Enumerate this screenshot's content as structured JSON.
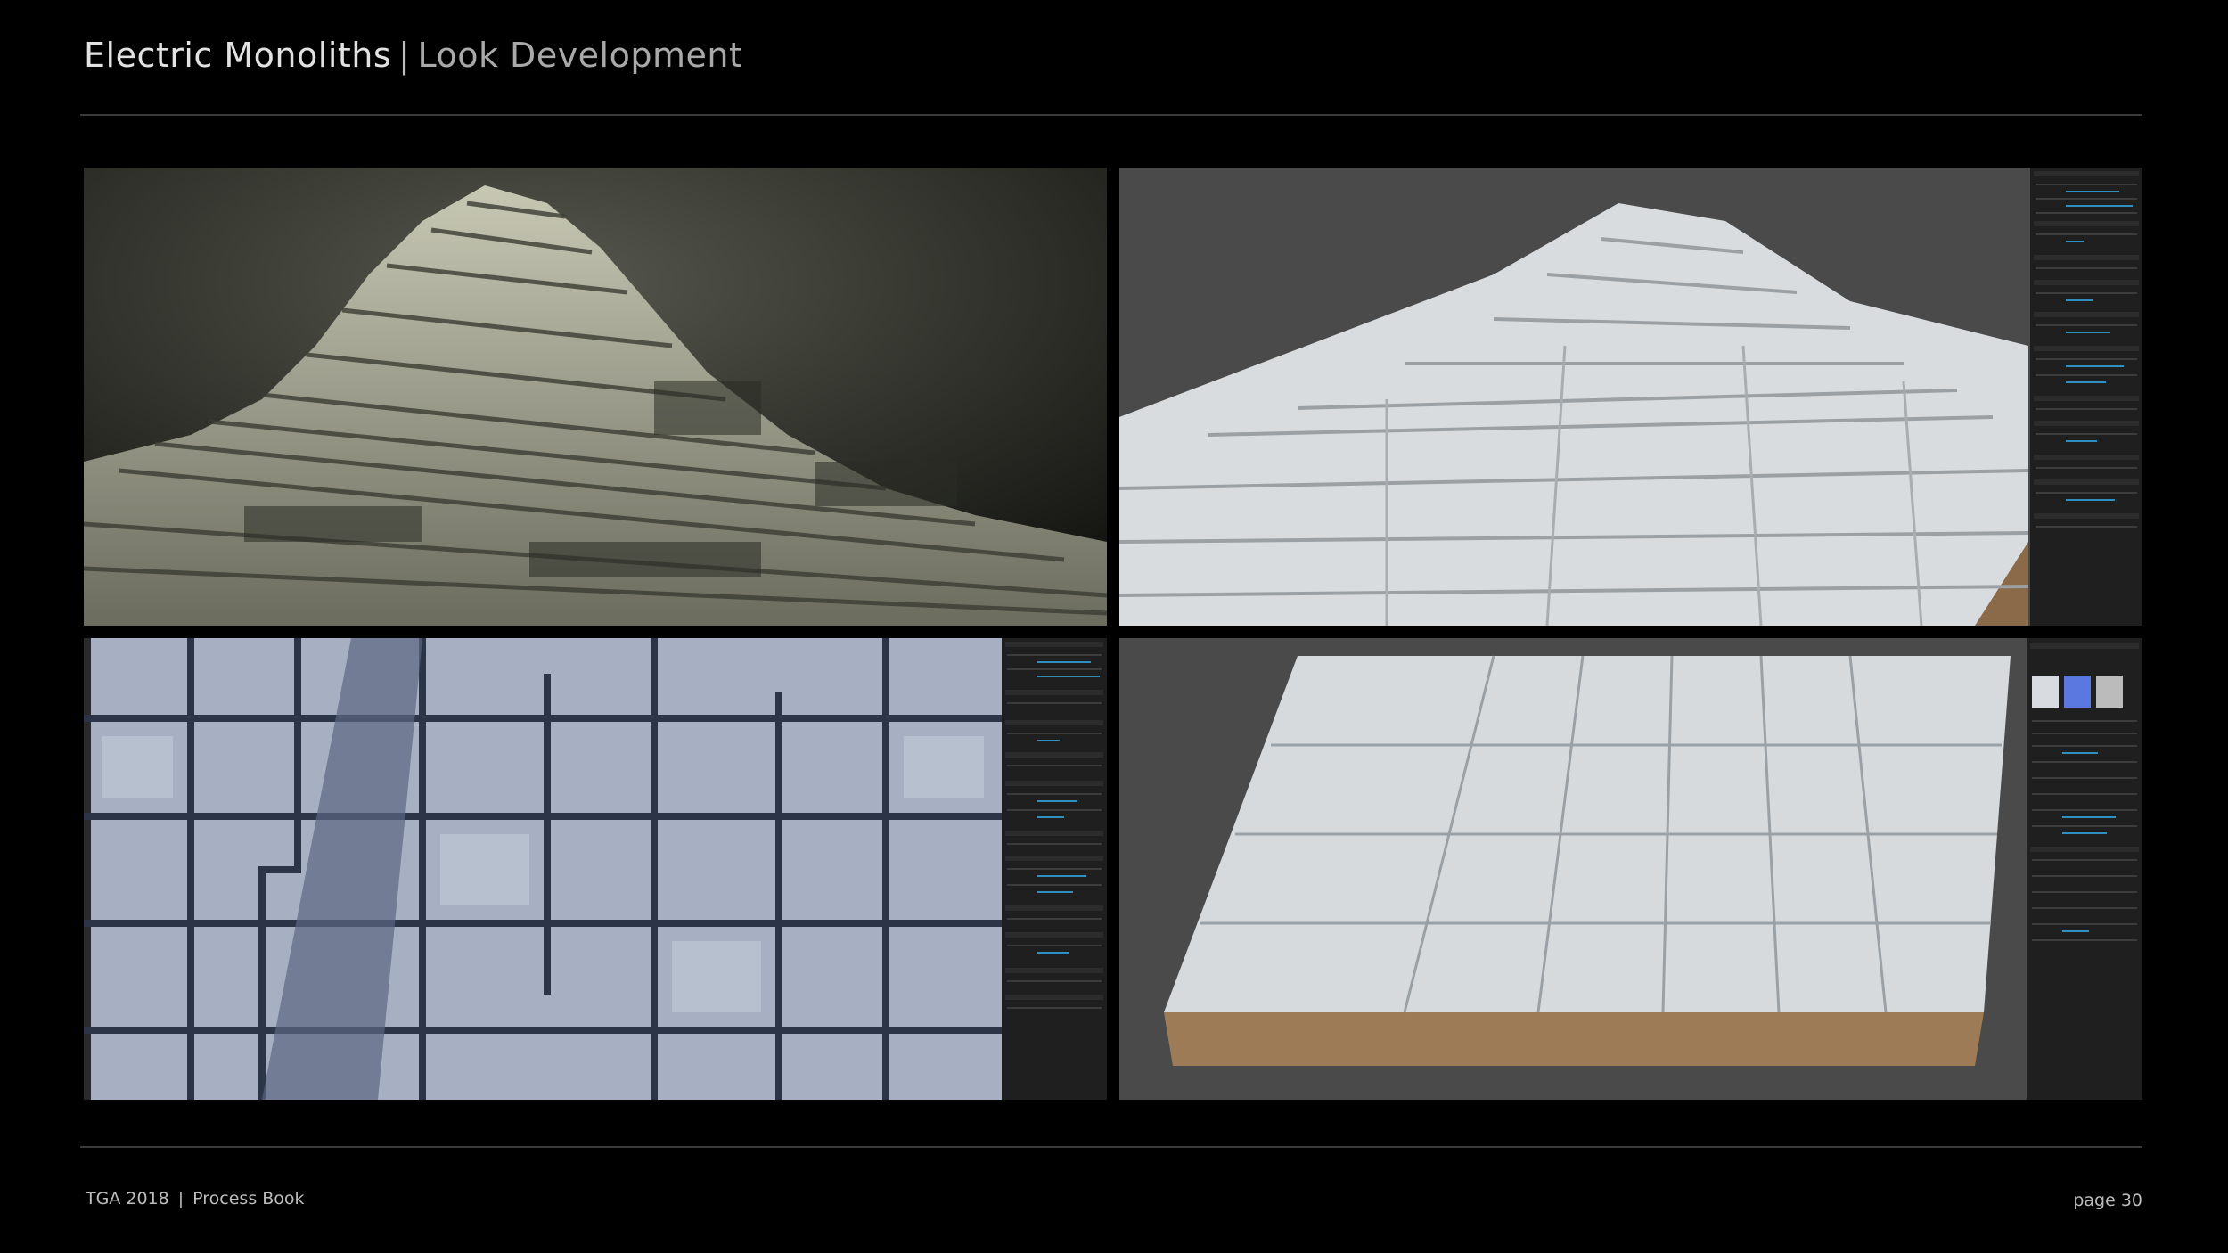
{
  "header": {
    "title_main": "Electric Monoliths",
    "separator": "|",
    "title_sub": "Look Development"
  },
  "panels": [
    {
      "id": "render-fog",
      "description_icon": "terraced-mountain-render"
    },
    {
      "id": "viewport-perspective",
      "description_icon": "terraced-mountain-viewport"
    },
    {
      "id": "viewport-topdown",
      "description_icon": "top-down-terrain-viewport"
    },
    {
      "id": "viewport-slab",
      "description_icon": "terrain-slab-viewport"
    }
  ],
  "footer": {
    "left_text": "TGA 2018",
    "separator": "|",
    "left_sub": "Process Book",
    "page": "page 30"
  },
  "colors": {
    "background": "#000000",
    "rule": "#3a3a3a",
    "viewport_grey": "#4a4a4a",
    "ui_panel": "#1f1f1f",
    "ui_accent": "#2f8fbf"
  }
}
